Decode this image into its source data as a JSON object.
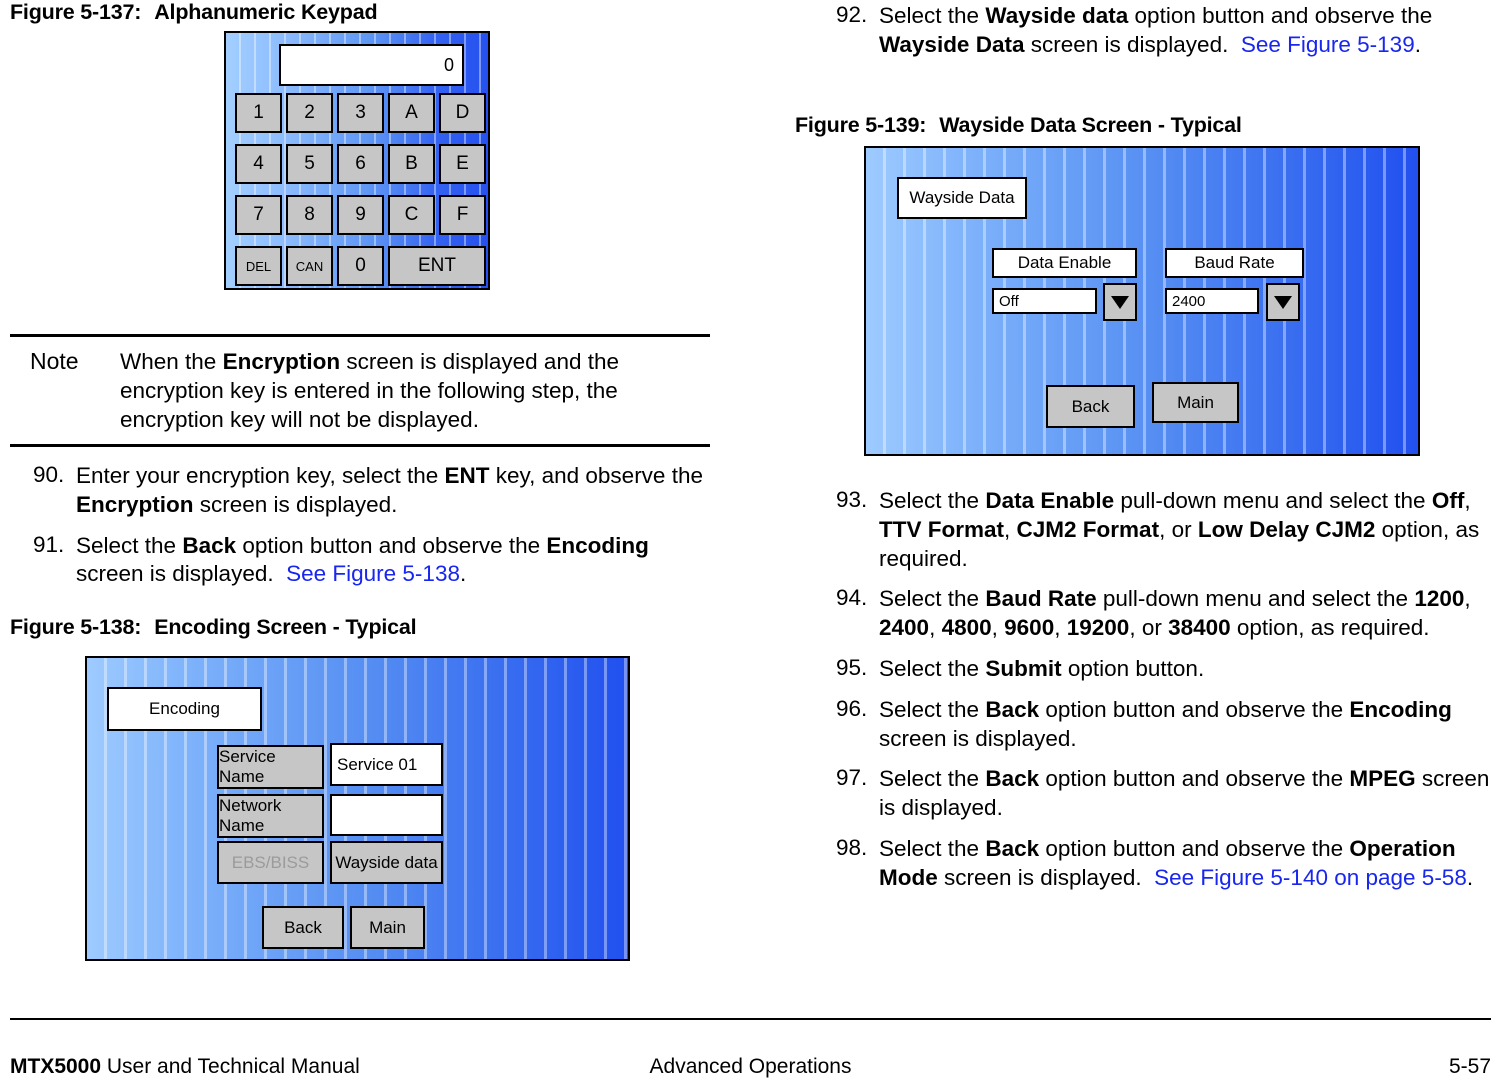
{
  "figures": {
    "keypad": {
      "caption_num": "Figure 5-137:",
      "caption_title": "Alphanumeric Keypad",
      "display_value": "0",
      "keys": [
        {
          "label": "1"
        },
        {
          "label": "2"
        },
        {
          "label": "3"
        },
        {
          "label": "A"
        },
        {
          "label": "D"
        },
        {
          "label": "4"
        },
        {
          "label": "5"
        },
        {
          "label": "6"
        },
        {
          "label": "B"
        },
        {
          "label": "E"
        },
        {
          "label": "7"
        },
        {
          "label": "8"
        },
        {
          "label": "9"
        },
        {
          "label": "C"
        },
        {
          "label": "F"
        },
        {
          "label": "DEL"
        },
        {
          "label": "CAN"
        },
        {
          "label": "0"
        },
        {
          "label": "ENT"
        }
      ]
    },
    "encoding": {
      "caption_num": "Figure 5-138:",
      "caption_title": "Encoding Screen - Typical",
      "title_box": "Encoding",
      "service_name_label": "Service Name",
      "service_name_value": "Service 01",
      "network_name_label": "Network Name",
      "network_name_value": "",
      "ebs_biss_label": "EBS/BISS",
      "wayside_data_label": "Wayside data",
      "back_label": "Back",
      "main_label": "Main"
    },
    "wayside": {
      "caption_num": "Figure 5-139:",
      "caption_title": "Wayside Data Screen - Typical",
      "title_box": "Wayside Data",
      "data_enable_label": "Data Enable",
      "data_enable_value": "Off",
      "baud_rate_label": "Baud Rate",
      "baud_rate_value": "2400",
      "back_label": "Back",
      "main_label": "Main"
    }
  },
  "note": {
    "label": "Note",
    "text_html": "When the <b>Encryption</b> screen is displayed and the encryption key is entered in the following step, the encryption key will not be displayed."
  },
  "steps_left": [
    {
      "num": "90.",
      "html": "Enter your encryption key, select the <b>ENT</b> key, and observe the <b>Encryption</b> screen is displayed."
    },
    {
      "num": "91.",
      "html": "Select the <b>Back</b> option button and observe the <b>Encoding</b> screen is displayed.&nbsp; <span class=\"lnk\">See Figure 5-138</span>."
    }
  ],
  "steps_right": [
    {
      "num": "92.",
      "html": "Select the <b>Wayside data</b> option button and observe the <b>Wayside Data</b> screen is displayed.&nbsp; <span class=\"lnk\">See Figure 5-139</span>."
    },
    {
      "num": "93.",
      "html": "Select the <b>Data Enable</b> pull-down menu and select the <b>Off</b>, <b>TTV Format</b>, <b>CJM2 Format</b>, or <b>Low Delay CJM2</b> option, as required."
    },
    {
      "num": "94.",
      "html": "Select the <b>Baud Rate</b> pull-down menu and select the <b>1200</b>, <b>2400</b>, <b>4800</b>, <b>9600</b>, <b>19200</b>, or <b>38400</b> option, as required."
    },
    {
      "num": "95.",
      "html": "Select the <b>Submit</b> option button."
    },
    {
      "num": "96.",
      "html": "Select the <b>Back</b> option button and observe the <b>Encoding</b> screen is displayed."
    },
    {
      "num": "97.",
      "html": "Select the <b>Back</b> option button and observe the <b>MPEG</b> screen is displayed."
    },
    {
      "num": "98.",
      "html": "Select the <b>Back</b> option button and observe the <b>Operation Mode</b> screen is displayed.&nbsp; <span class=\"lnk\">See Figure 5-140 on page 5-58</span>."
    }
  ],
  "footer": {
    "product": "MTX5000",
    "manual": " User and Technical Manual",
    "section": "Advanced Operations",
    "page": "5-57"
  },
  "colors": {
    "link": "#1826ef",
    "button_grey": "#c6c6c6",
    "gradient_light": "#9ecbff",
    "gradient_dark": "#2150ef"
  }
}
